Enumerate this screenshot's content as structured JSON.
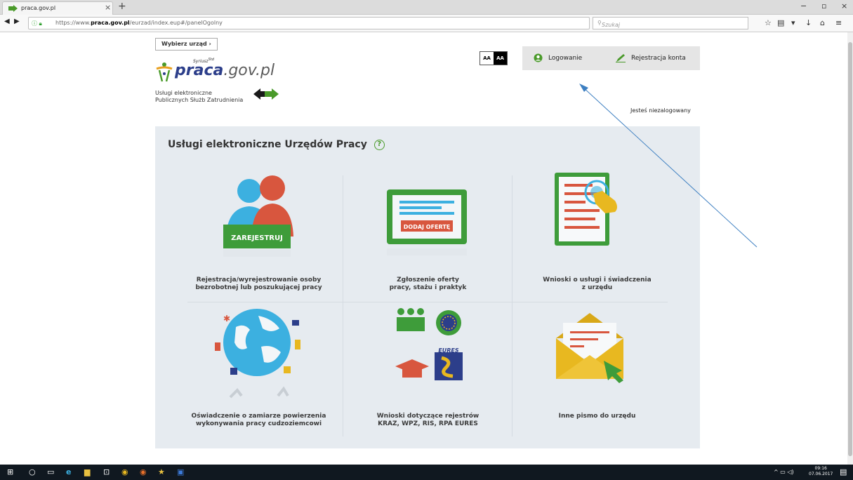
{
  "browser": {
    "tab_title": "praca.gov.pl",
    "tab_close": "×",
    "new_tab": "+",
    "url_prefix": "https://www.",
    "url_domain": "praca.gov.pl",
    "url_path": "/eurzad/index.eup#/panelOgolny",
    "search_placeholder": "Szukaj",
    "window_min": "−",
    "window_max": "▫",
    "window_close": "×"
  },
  "header": {
    "choose_office_label": "Wybierz urząd",
    "logo_text": "praca",
    "logo_text_suffix": ".gov.pl",
    "logo_tagline": "Syriusz",
    "logo_tagline_sup": "Std",
    "logo_desc_line1": "Usługi elektroniczne",
    "logo_desc_line2": "Publicznych Służb Zatrudnienia",
    "contrast_normal": "AA",
    "contrast_high": "AA",
    "login_label": "Logowanie",
    "register_label": "Rejestracja konta",
    "status_text": "Jesteś niezalogowany"
  },
  "panel": {
    "title": "Usługi elektroniczne Urzędów Pracy",
    "help_icon": "?",
    "tiles": [
      {
        "line1": "Rejestracja/wyrejestrowanie osoby",
        "line2": "bezrobotnej lub poszukującej pracy",
        "badge": "ZAREJESTRUJ",
        "icon": "people-register-icon"
      },
      {
        "line1": "Zgłoszenie oferty",
        "line2": "pracy, stażu i praktyk",
        "badge": "DODAJ OFERTĘ",
        "icon": "job-offer-screen-icon"
      },
      {
        "line1": "Wnioski o usługi i świadczenia",
        "line2": "z urzędu",
        "icon": "document-hand-icon"
      },
      {
        "line1": "Oświadczenie o zamiarze powierzenia",
        "line2": "wykonywania pracy cudzoziemcowi",
        "icon": "globe-flags-icon"
      },
      {
        "line1": "Wnioski dotyczące rejestrów",
        "line2": "KRAZ, WPZ, RIS, RPA EURES",
        "badge": "EURES",
        "icon": "registers-icon"
      },
      {
        "line1": "Inne pismo do urzędu",
        "line2": "",
        "icon": "envelope-letter-icon"
      }
    ]
  },
  "taskbar": {
    "time": "09:16",
    "date": "07.06.2017"
  },
  "colors": {
    "brand_blue": "#2c3e8a",
    "brand_green": "#4a9a2a",
    "panel_bg": "#e6ebf0",
    "annotation_arrow": "#3d7fc1"
  }
}
